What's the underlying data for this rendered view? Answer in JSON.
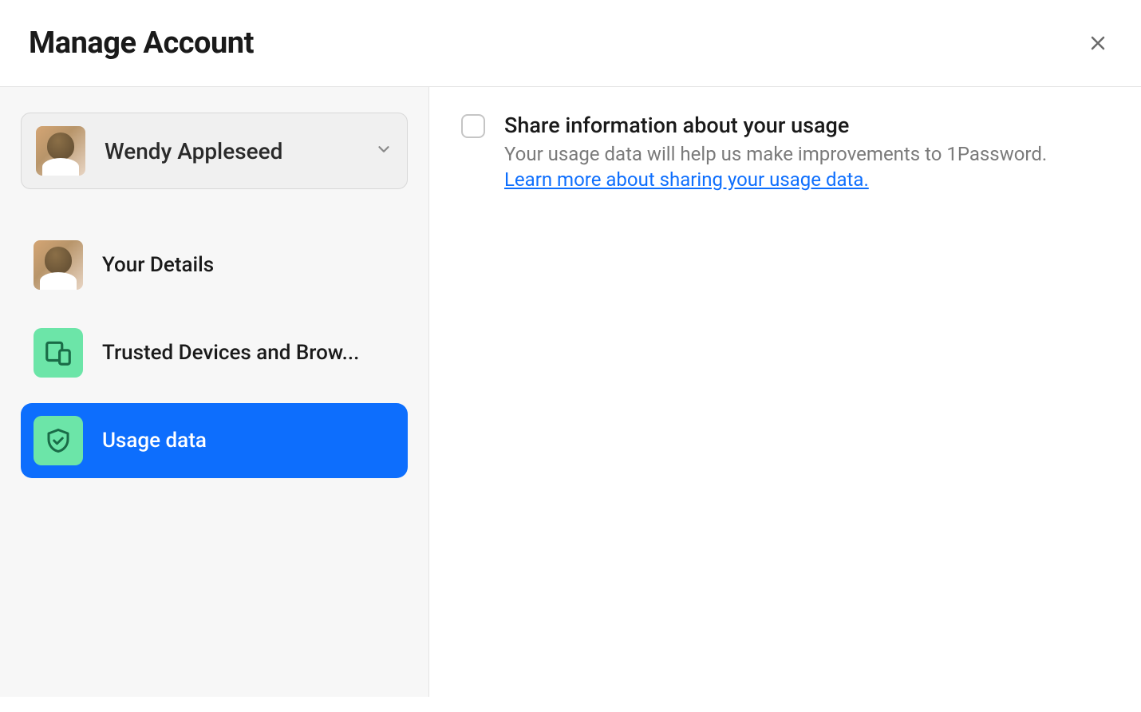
{
  "header": {
    "title": "Manage Account"
  },
  "account": {
    "name": "Wendy Appleseed"
  },
  "sidebar": {
    "items": [
      {
        "label": "Your Details",
        "icon": "avatar",
        "active": false
      },
      {
        "label": "Trusted Devices and Brow...",
        "icon": "devices",
        "active": false
      },
      {
        "label": "Usage data",
        "icon": "shield",
        "active": true
      }
    ]
  },
  "main": {
    "setting": {
      "title": "Share information about your usage",
      "description": "Your usage data will help us make improvements to 1Password.",
      "link_text": "Learn more about sharing your usage data.",
      "checked": false
    }
  }
}
